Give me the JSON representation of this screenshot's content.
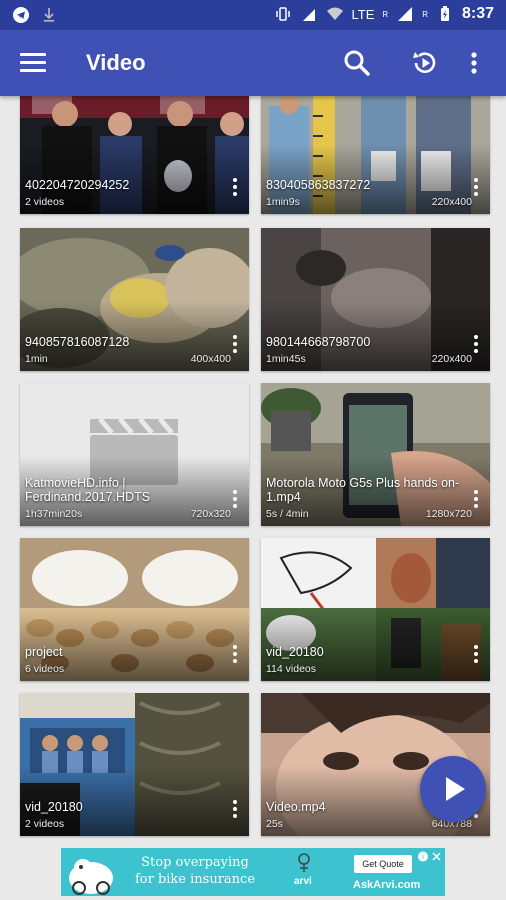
{
  "status_bar": {
    "network": "LTE",
    "roaming_left": "R",
    "roaming_right": "R",
    "time": "8:37"
  },
  "app_bar": {
    "title": "Video",
    "icons": [
      "menu-icon",
      "search-icon",
      "history-play-icon",
      "overflow-menu-icon"
    ]
  },
  "videos": [
    {
      "title": "402204720294252",
      "subtitle": "2 videos",
      "resolution": "",
      "thumb": "press-conference"
    },
    {
      "title": "830405863837272",
      "subtitle": "1min9s",
      "resolution": "220x400",
      "thumb": "height-chart"
    },
    {
      "title": "940857816087128",
      "subtitle": "1min",
      "resolution": "400x400",
      "thumb": "blurry-crowd"
    },
    {
      "title": "980144668798700",
      "subtitle": "1min45s",
      "resolution": "220x400",
      "thumb": "dark-room"
    },
    {
      "title": "KatmovieHD.info | Ferdinand.2017.HDTS",
      "subtitle": "1h37min20s",
      "resolution": "720x320",
      "thumb": "placeholder-clapper"
    },
    {
      "title": "Motorola Moto G5s Plus hands on-1.mp4",
      "subtitle": "5s / 4min",
      "resolution": "1280x720",
      "thumb": "phone-in-hand"
    },
    {
      "title": "project",
      "subtitle": "6 videos",
      "resolution": "",
      "thumb": "rice-pistachio"
    },
    {
      "title": "vid_20180",
      "subtitle": "114 videos",
      "resolution": "",
      "thumb": "drawing-collage"
    },
    {
      "title": "vid_20180",
      "subtitle": "2 videos",
      "resolution": "",
      "thumb": "bus-crowd"
    },
    {
      "title": "Video.mp4",
      "subtitle": "25s",
      "resolution": "640x788",
      "thumb": "child-face"
    }
  ],
  "fab": {
    "icon": "play-icon"
  },
  "ad": {
    "headline": "Stop overpaying for bike insurance",
    "brand": "arvi",
    "cta": "Get Quote",
    "site": "AskArvi.com",
    "accent": "#3cc3cf"
  },
  "colors": {
    "status_bar": "#2c3e9c",
    "app_bar": "#3f51b5",
    "background": "#e9e9e9"
  }
}
